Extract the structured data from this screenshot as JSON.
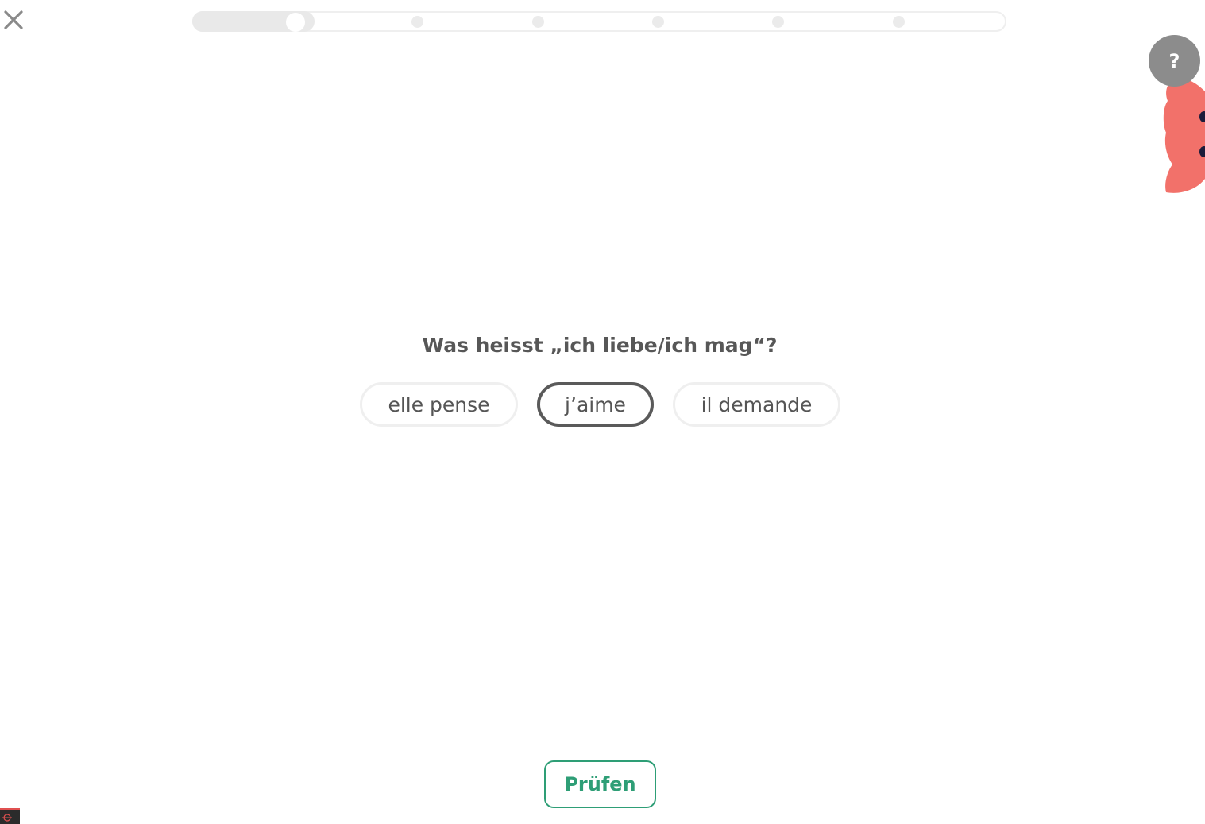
{
  "header": {
    "close_icon": "close-icon",
    "progress": {
      "total_steps": 6,
      "current_step": 1,
      "fraction_complete": 0.15
    }
  },
  "help": {
    "label": "?",
    "icon": "help-icon"
  },
  "mascot": {
    "icon": "mascot-icon",
    "color": "#f2716a"
  },
  "exercise": {
    "question": "Was heisst „ich liebe/ich mag“?",
    "options": [
      {
        "label": "elle pense",
        "selected": false
      },
      {
        "label": "j’aime",
        "selected": true
      },
      {
        "label": "il demande",
        "selected": false
      }
    ]
  },
  "footer": {
    "check_label": "Prüfen"
  },
  "colors": {
    "accent_green": "#2e9e76",
    "text": "#575757",
    "border_light": "#efefef",
    "border_selected": "#5a5a5a",
    "help_grey": "#8c8c8c"
  }
}
